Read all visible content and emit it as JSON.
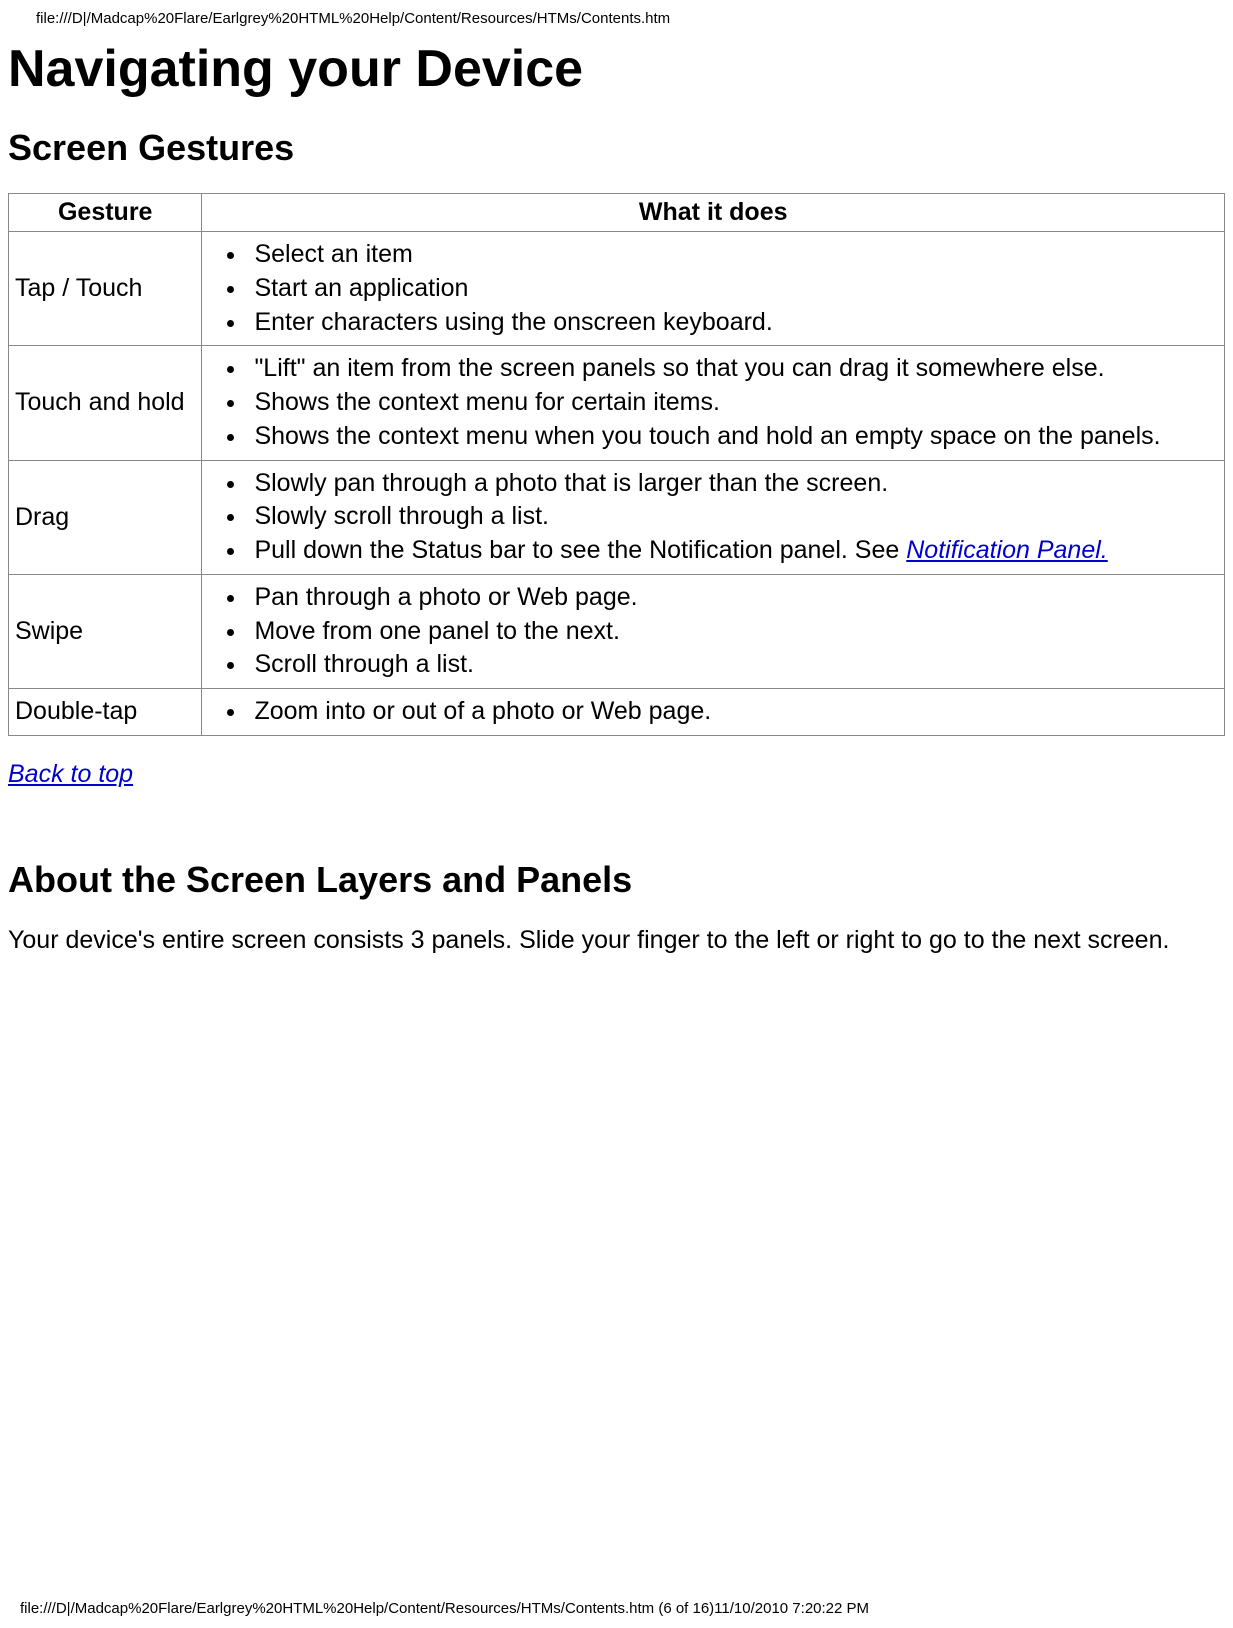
{
  "header_path": "file:///D|/Madcap%20Flare/Earlgrey%20HTML%20Help/Content/Resources/HTMs/Contents.htm",
  "h1": "Navigating your Device",
  "section1_title": "Screen Gestures",
  "table": {
    "col1": "Gesture",
    "col2": "What it does",
    "rows": [
      {
        "gesture": "Tap / Touch",
        "items": [
          "Select an item",
          "Start an application",
          "Enter characters using the onscreen keyboard."
        ]
      },
      {
        "gesture": "Touch and hold",
        "items": [
          "\"Lift\" an item from the screen panels so that you can drag it somewhere else.",
          "Shows the context menu for certain items.",
          "Shows the context menu when you touch and hold an empty space on the panels."
        ]
      },
      {
        "gesture": "Drag",
        "items_pre_link": [
          "Slowly pan through a photo that is larger than the screen.",
          "Slowly scroll through a list."
        ],
        "item_link_prefix": "Pull down the Status bar to see the Notification panel. See ",
        "item_link_text": "Notification Panel."
      },
      {
        "gesture": "Swipe",
        "items": [
          "Pan through a photo or Web page.",
          "Move from one panel to the next.",
          "Scroll through a list."
        ]
      },
      {
        "gesture": "Double-tap",
        "items": [
          "Zoom into or out of a photo or Web page."
        ]
      }
    ]
  },
  "back_to_top": "Back to top",
  "section2_title": "About the Screen Layers and Panels",
  "body_para": "Your device's entire screen consists 3 panels. Slide your finger to the left or right to go to the next screen.",
  "footer": "file:///D|/Madcap%20Flare/Earlgrey%20HTML%20Help/Content/Resources/HTMs/Contents.htm (6 of 16)11/10/2010 7:20:22 PM"
}
